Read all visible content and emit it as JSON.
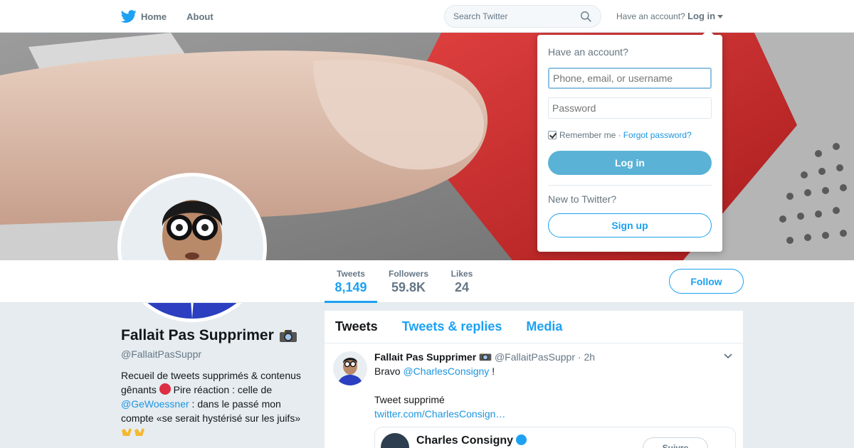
{
  "nav": {
    "home_label": "Home",
    "about_label": "About",
    "search_placeholder": "Search Twitter",
    "have_account_text": "Have an account?",
    "login_link": "Log in"
  },
  "profile": {
    "name": "Fallait Pas Supprimer",
    "handle": "@FallaitPasSuppr",
    "bio_part1": "Recueil de tweets supprimés & contenus gênants",
    "bio_part2": "Pire réaction : celle de",
    "bio_mention": "@GeWoessner",
    "bio_part3": ": dans le passé mon compte «se serait hystérisé sur les juifs»"
  },
  "stats": [
    {
      "label": "Tweets",
      "value": "8,149"
    },
    {
      "label": "Followers",
      "value": "59.8K"
    },
    {
      "label": "Likes",
      "value": "24"
    }
  ],
  "follow_label": "Follow",
  "timeline": {
    "tabs": [
      "Tweets",
      "Tweets & replies",
      "Media"
    ],
    "tweet": {
      "author": "Fallait Pas Supprimer",
      "handle": "@FallaitPasSuppr",
      "time": "· 2h",
      "text_prefix": "Bravo",
      "mention": "@CharlesConsigny",
      "text_suffix": "!",
      "line2": "Tweet supprimé",
      "link": "twitter.com/CharlesConsign…",
      "quoted_name": "Charles Consigny",
      "quoted_button": "Suivre"
    }
  },
  "login_dropdown": {
    "title": "Have an account?",
    "username_placeholder": "Phone, email, or username",
    "password_placeholder": "Password",
    "remember_label": "Remember me",
    "separator": "·",
    "forgot_label": "Forgot password?",
    "login_button": "Log in",
    "new_to_label": "New to Twitter?",
    "signup_button": "Sign up"
  },
  "colors": {
    "accent": "#1da1f2",
    "login_button": "#5ab2d6",
    "background": "#e6ecf0"
  }
}
